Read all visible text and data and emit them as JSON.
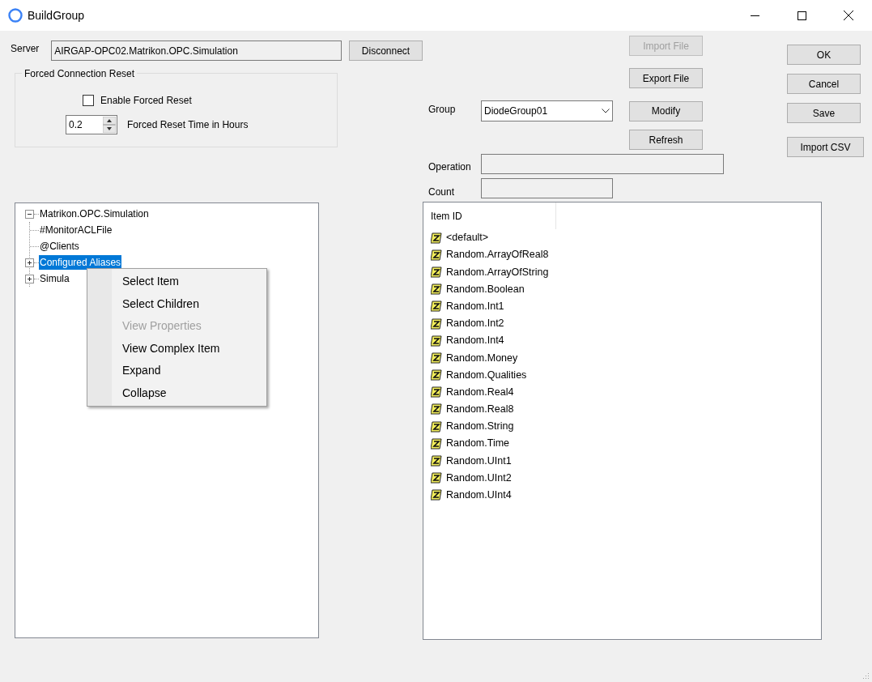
{
  "window": {
    "title": "BuildGroup"
  },
  "server": {
    "label": "Server",
    "value": "AIRGAP-OPC02.Matrikon.OPC.Simulation",
    "disconnect_button": "Disconnect"
  },
  "forced_reset": {
    "title": "Forced Connection Reset",
    "enable": {
      "label": "Enable Forced Reset",
      "checked": false
    },
    "time": {
      "value": "0.2",
      "label": "Forced Reset Time in Hours"
    }
  },
  "file_buttons": [
    {
      "label": "Import File",
      "disabled": true
    },
    {
      "label": "Export File",
      "disabled": false
    }
  ],
  "group": {
    "label": "Group",
    "value": "DiodeGroup01"
  },
  "modify_button": "Modify",
  "refresh_button": "Refresh",
  "operation": {
    "label": "Operation"
  },
  "count": {
    "label": "Count"
  },
  "dialog_buttons": [
    "OK",
    "Cancel",
    "Save"
  ],
  "import_csv_button": "Import CSV",
  "tree": {
    "items": [
      {
        "label": "Matrikon.OPC.Simulation",
        "kind": "branch",
        "expanded": true,
        "selected": false,
        "children": [
          {
            "label": "#MonitorACLFile",
            "kind": "leaf",
            "selected": false
          },
          {
            "label": "@Clients",
            "kind": "leaf",
            "selected": false
          },
          {
            "label": "Configured Aliases",
            "kind": "branch",
            "expanded": false,
            "selected": true
          },
          {
            "label": "Simula",
            "kind": "branch",
            "expanded": false,
            "selected": false
          }
        ]
      }
    ]
  },
  "context_menu": {
    "items": [
      {
        "label": "Select Item",
        "disabled": false
      },
      {
        "label": "Select Children",
        "disabled": false
      },
      {
        "label": "View Properties",
        "disabled": true
      },
      {
        "label": "View Complex Item",
        "disabled": false
      },
      {
        "label": "Expand",
        "disabled": false
      },
      {
        "label": "Collapse",
        "disabled": false
      }
    ]
  },
  "item_list": {
    "column": "Item ID",
    "items": [
      "<default>",
      "Random.ArrayOfReal8",
      "Random.ArrayOfString",
      "Random.Boolean",
      "Random.Int1",
      "Random.Int2",
      "Random.Int4",
      "Random.Money",
      "Random.Qualities",
      "Random.Real4",
      "Random.Real8",
      "Random.String",
      "Random.Time",
      "Random.UInt1",
      "Random.UInt2",
      "Random.UInt4"
    ]
  }
}
